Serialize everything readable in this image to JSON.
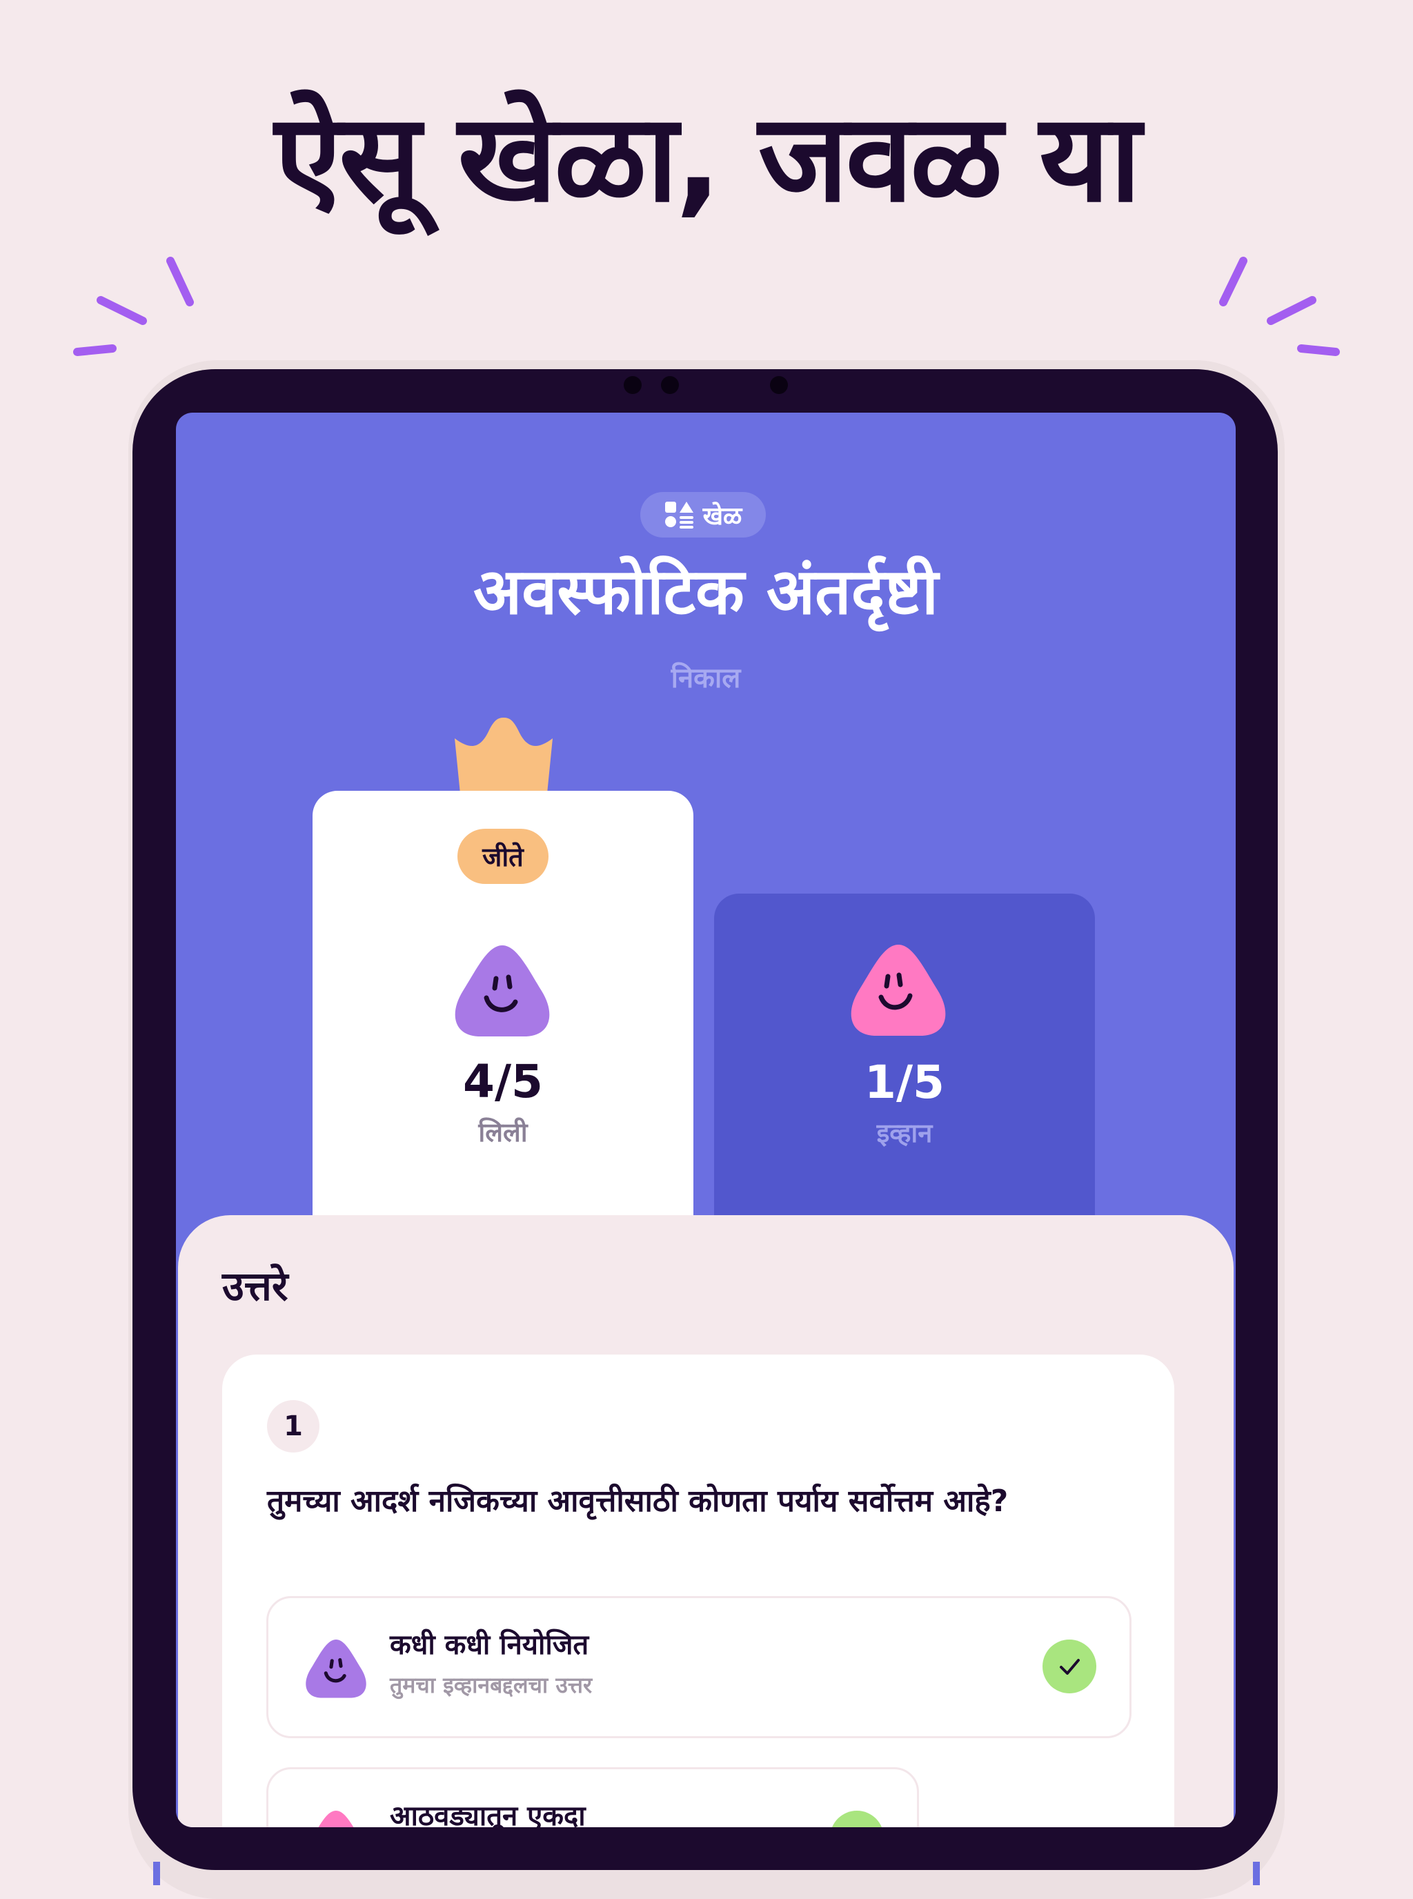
{
  "headline": "ऐसू खेळा, जवळ या",
  "game": {
    "chip_label": "खेळ",
    "chip_icon": "shapes-icon",
    "title": "अवस्फोटिक अंतर्दृष्टी",
    "subtitle": "निकाल"
  },
  "players": [
    {
      "badge": "जीते",
      "score": "4/5",
      "name": "लिली",
      "avatar_color": "#a879e6",
      "winner": true
    },
    {
      "score": "1/5",
      "name": "इव्हान",
      "avatar_color": "#ff79c2",
      "winner": false
    }
  ],
  "answers_sheet": {
    "title": "उत्तरे",
    "question": {
      "number": "1",
      "text": "तुमच्या आदर्श नजिकच्या आवृत्तीसाठी कोणता पर्याय सर्वोत्तम आहे?",
      "options": [
        {
          "title": "कधी कधी नियोजित",
          "subtitle": "तुमचा इव्हानबद्दलचा उत्तर",
          "avatar_color": "#a879e6",
          "correct": true
        },
        {
          "title": "आठवड्यातून एकदा",
          "subtitle": "",
          "avatar_color": "#ff79c2",
          "correct": true
        }
      ]
    }
  },
  "colors": {
    "background": "#f5e9ec",
    "screen": "#6b6fe1",
    "loser_card": "#5257cd",
    "badge": "#f9bf80",
    "accent_spark": "#a35ef0",
    "check": "#a9e57f",
    "ink": "#1c0a2e"
  }
}
